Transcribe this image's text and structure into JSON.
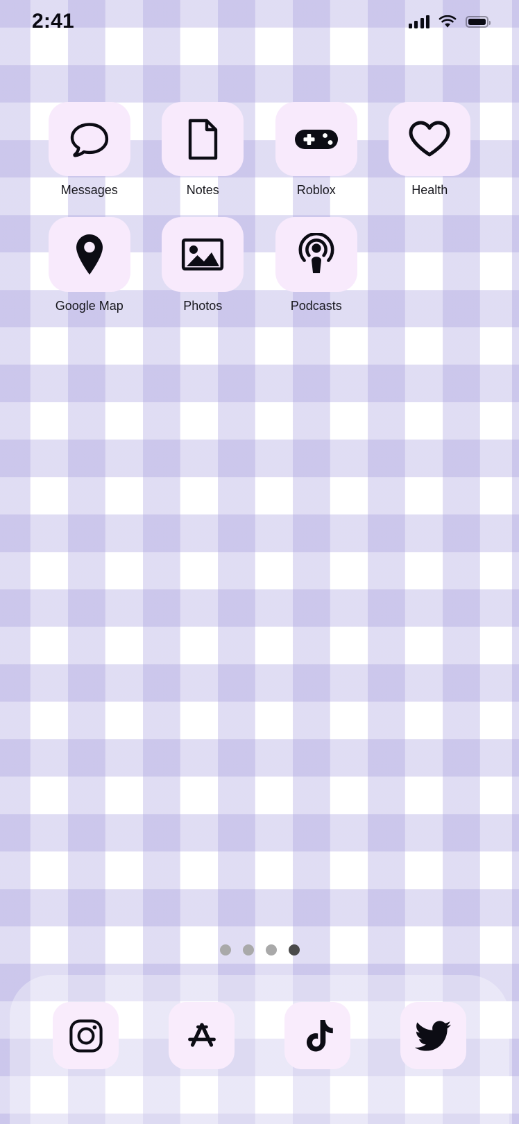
{
  "status_bar": {
    "time": "2:41",
    "signal_icon": "cellular-signal-icon",
    "signal_bars": 4,
    "wifi_icon": "wifi-icon",
    "battery_icon": "battery-full-icon",
    "battery_level": 100
  },
  "home_screen": {
    "rows": [
      {
        "apps": [
          {
            "label": "Messages",
            "icon": "message-bubble-icon"
          },
          {
            "label": "Notes",
            "icon": "document-page-icon"
          },
          {
            "label": "Roblox",
            "icon": "game-controller-icon"
          },
          {
            "label": "Health",
            "icon": "heart-outline-icon"
          }
        ]
      },
      {
        "apps": [
          {
            "label": "Google Map",
            "icon": "map-pin-icon"
          },
          {
            "label": "Photos",
            "icon": "photo-picture-icon"
          },
          {
            "label": "Podcasts",
            "icon": "podcast-antenna-icon"
          }
        ]
      }
    ]
  },
  "page_indicator": {
    "total_pages": 4,
    "active_page": 4
  },
  "dock": {
    "apps": [
      {
        "label": "Instagram",
        "icon": "instagram-camera-icon"
      },
      {
        "label": "App Store",
        "icon": "app-store-icon"
      },
      {
        "label": "TikTok",
        "icon": "tiktok-note-icon"
      },
      {
        "label": "Twitter",
        "icon": "twitter-bird-icon"
      }
    ]
  },
  "theme": {
    "tile_color": "#f8eafc",
    "icon_color": "#0c0c14",
    "label_color": "#17171d",
    "background_check_color": "#a49cdd",
    "background_base_color": "#ffffff",
    "dot_inactive_color": "#a9a9a9",
    "dot_active_color": "#4a4a4a"
  }
}
